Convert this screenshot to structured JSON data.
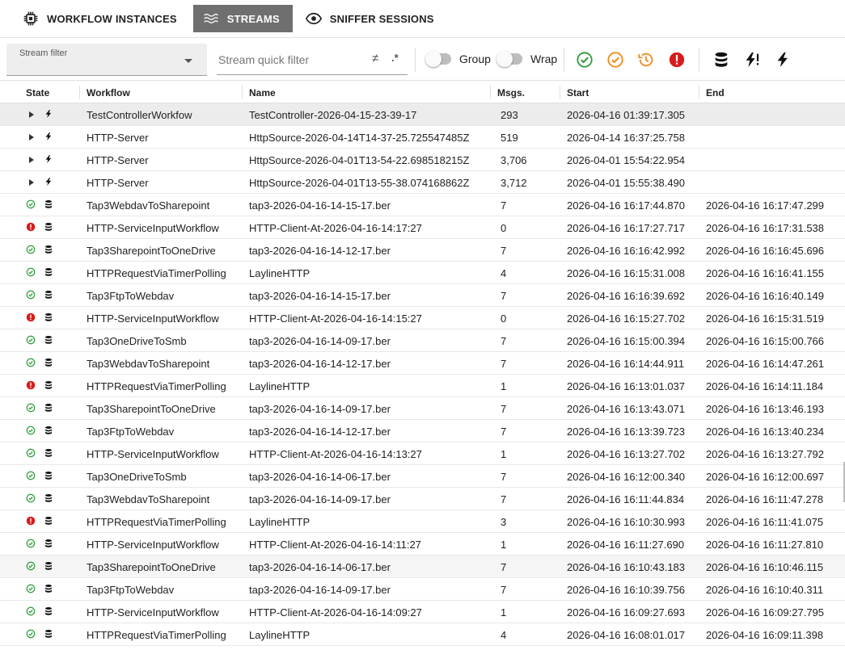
{
  "tabs": [
    {
      "label": "WORKFLOW INSTANCES",
      "icon": "chip-icon",
      "active": false
    },
    {
      "label": "STREAMS",
      "icon": "waves-icon",
      "active": true
    },
    {
      "label": "SNIFFER SESSIONS",
      "icon": "eye-icon",
      "active": false
    }
  ],
  "toolbar": {
    "stream_filter_label": "Stream filter",
    "stream_filter_value": "",
    "quick_filter_placeholder": "Stream quick filter",
    "quick_filter_value": "",
    "not_equal_glyph": "≠",
    "regex_glyph": ".*",
    "group_label": "Group",
    "group_on": false,
    "wrap_label": "Wrap",
    "wrap_on": false,
    "icons": [
      "success-filter-icon",
      "warning-filter-icon",
      "history-filter-icon",
      "error-filter-icon",
      "database-icon",
      "flash-alert-icon",
      "flash-icon"
    ],
    "colors": {
      "success": "#2e9c3a",
      "warning": "#f08a1c",
      "error": "#d91b1b"
    }
  },
  "table": {
    "columns": [
      "State",
      "Workflow",
      "Name",
      "Msgs.",
      "Start",
      "End"
    ],
    "rows": [
      {
        "state": "running",
        "type": "flash",
        "workflow": "TestControllerWorkfow",
        "name": "TestController-2026-04-15-23-39-17",
        "msgs": "293",
        "start": "2026-04-16 01:39:17.305",
        "end": ""
      },
      {
        "state": "running",
        "type": "flash",
        "workflow": "HTTP-Server",
        "name": "HttpSource-2026-04-14T14-37-25.725547485Z",
        "msgs": "519",
        "start": "2026-04-14 16:37:25.758",
        "end": ""
      },
      {
        "state": "running",
        "type": "flash",
        "workflow": "HTTP-Server",
        "name": "HttpSource-2026-04-01T13-54-22.698518215Z",
        "msgs": "3,706",
        "start": "2026-04-01 15:54:22.954",
        "end": ""
      },
      {
        "state": "running",
        "type": "flash",
        "workflow": "HTTP-Server",
        "name": "HttpSource-2026-04-01T13-55-38.074168862Z",
        "msgs": "3,712",
        "start": "2026-04-01 15:55:38.490",
        "end": ""
      },
      {
        "state": "ok",
        "type": "db",
        "workflow": "Tap3WebdavToSharepoint",
        "name": "tap3-2026-04-16-14-15-17.ber",
        "msgs": "7",
        "start": "2026-04-16 16:17:44.870",
        "end": "2026-04-16 16:17:47.299"
      },
      {
        "state": "error",
        "type": "db",
        "workflow": "HTTP-ServiceInputWorkflow",
        "name": "HTTP-Client-At-2026-04-16-14:17:27",
        "msgs": "0",
        "start": "2026-04-16 16:17:27.717",
        "end": "2026-04-16 16:17:31.538"
      },
      {
        "state": "ok",
        "type": "db",
        "workflow": "Tap3SharepointToOneDrive",
        "name": "tap3-2026-04-16-14-12-17.ber",
        "msgs": "7",
        "start": "2026-04-16 16:16:42.992",
        "end": "2026-04-16 16:16:45.696"
      },
      {
        "state": "ok",
        "type": "db",
        "workflow": "HTTPRequestViaTimerPolling",
        "name": "LaylineHTTP",
        "msgs": "4",
        "start": "2026-04-16 16:15:31.008",
        "end": "2026-04-16 16:16:41.155"
      },
      {
        "state": "ok",
        "type": "db",
        "workflow": "Tap3FtpToWebdav",
        "name": "tap3-2026-04-16-14-15-17.ber",
        "msgs": "7",
        "start": "2026-04-16 16:16:39.692",
        "end": "2026-04-16 16:16:40.149"
      },
      {
        "state": "error",
        "type": "db",
        "workflow": "HTTP-ServiceInputWorkflow",
        "name": "HTTP-Client-At-2026-04-16-14:15:27",
        "msgs": "0",
        "start": "2026-04-16 16:15:27.702",
        "end": "2026-04-16 16:15:31.519"
      },
      {
        "state": "ok",
        "type": "db",
        "workflow": "Tap3OneDriveToSmb",
        "name": "tap3-2026-04-16-14-09-17.ber",
        "msgs": "7",
        "start": "2026-04-16 16:15:00.394",
        "end": "2026-04-16 16:15:00.766"
      },
      {
        "state": "ok",
        "type": "db",
        "workflow": "Tap3WebdavToSharepoint",
        "name": "tap3-2026-04-16-14-12-17.ber",
        "msgs": "7",
        "start": "2026-04-16 16:14:44.911",
        "end": "2026-04-16 16:14:47.261"
      },
      {
        "state": "error",
        "type": "db",
        "workflow": "HTTPRequestViaTimerPolling",
        "name": "LaylineHTTP",
        "msgs": "1",
        "start": "2026-04-16 16:13:01.037",
        "end": "2026-04-16 16:14:11.184"
      },
      {
        "state": "ok",
        "type": "db",
        "workflow": "Tap3SharepointToOneDrive",
        "name": "tap3-2026-04-16-14-09-17.ber",
        "msgs": "7",
        "start": "2026-04-16 16:13:43.071",
        "end": "2026-04-16 16:13:46.193"
      },
      {
        "state": "ok",
        "type": "db",
        "workflow": "Tap3FtpToWebdav",
        "name": "tap3-2026-04-16-14-12-17.ber",
        "msgs": "7",
        "start": "2026-04-16 16:13:39.723",
        "end": "2026-04-16 16:13:40.234"
      },
      {
        "state": "ok",
        "type": "db",
        "workflow": "HTTP-ServiceInputWorkflow",
        "name": "HTTP-Client-At-2026-04-16-14:13:27",
        "msgs": "1",
        "start": "2026-04-16 16:13:27.702",
        "end": "2026-04-16 16:13:27.792"
      },
      {
        "state": "ok",
        "type": "db",
        "workflow": "Tap3OneDriveToSmb",
        "name": "tap3-2026-04-16-14-06-17.ber",
        "msgs": "7",
        "start": "2026-04-16 16:12:00.340",
        "end": "2026-04-16 16:12:00.697"
      },
      {
        "state": "ok",
        "type": "db",
        "workflow": "Tap3WebdavToSharepoint",
        "name": "tap3-2026-04-16-14-09-17.ber",
        "msgs": "7",
        "start": "2026-04-16 16:11:44.834",
        "end": "2026-04-16 16:11:47.278"
      },
      {
        "state": "error",
        "type": "db",
        "workflow": "HTTPRequestViaTimerPolling",
        "name": "LaylineHTTP",
        "msgs": "3",
        "start": "2026-04-16 16:10:30.993",
        "end": "2026-04-16 16:11:41.075"
      },
      {
        "state": "ok",
        "type": "db",
        "workflow": "HTTP-ServiceInputWorkflow",
        "name": "HTTP-Client-At-2026-04-16-14:11:27",
        "msgs": "1",
        "start": "2026-04-16 16:11:27.690",
        "end": "2026-04-16 16:11:27.810"
      },
      {
        "state": "ok",
        "type": "db",
        "workflow": "Tap3SharepointToOneDrive",
        "name": "tap3-2026-04-16-14-06-17.ber",
        "msgs": "7",
        "start": "2026-04-16 16:10:43.183",
        "end": "2026-04-16 16:10:46.115"
      },
      {
        "state": "ok",
        "type": "db",
        "workflow": "Tap3FtpToWebdav",
        "name": "tap3-2026-04-16-14-09-17.ber",
        "msgs": "7",
        "start": "2026-04-16 16:10:39.756",
        "end": "2026-04-16 16:10:40.311"
      },
      {
        "state": "ok",
        "type": "db",
        "workflow": "HTTP-ServiceInputWorkflow",
        "name": "HTTP-Client-At-2026-04-16-14:09:27",
        "msgs": "1",
        "start": "2026-04-16 16:09:27.693",
        "end": "2026-04-16 16:09:27.795"
      },
      {
        "state": "ok",
        "type": "db",
        "workflow": "HTTPRequestViaTimerPolling",
        "name": "LaylineHTTP",
        "msgs": "4",
        "start": "2026-04-16 16:08:01.017",
        "end": "2026-04-16 16:09:11.398"
      }
    ]
  }
}
